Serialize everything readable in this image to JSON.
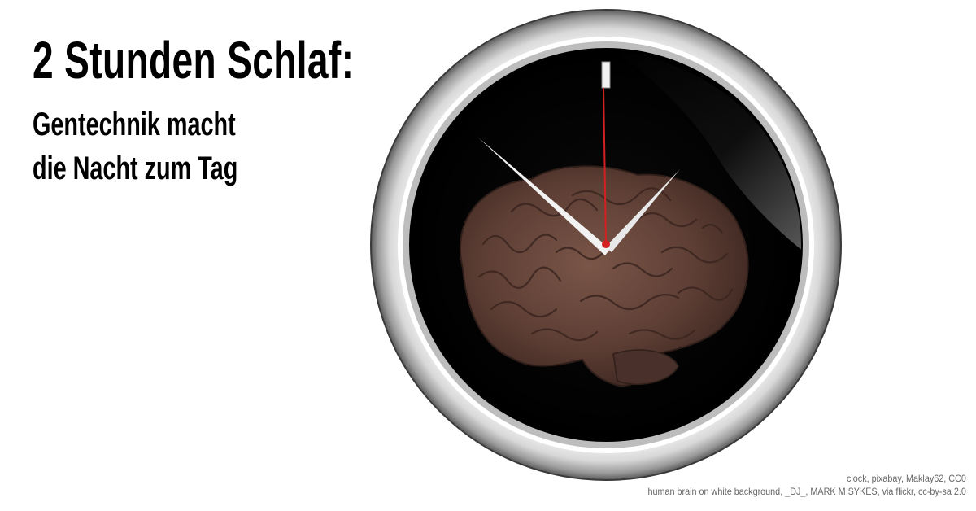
{
  "headline": {
    "title": "2 Stunden Schlaf:",
    "subtitle_line1": "Gentechnik macht",
    "subtitle_line2": "die Nacht zum Tag"
  },
  "credits": {
    "line1": "clock, pixabay, Maklay62, CC0",
    "line2": "human brain on white background, _DJ_, MARK M SYKES, via flickr, cc-by-sa 2.0"
  },
  "image": {
    "clock_face_color": "#000000",
    "clock_rim_color": "#e6e6e6",
    "brain_color": "#5a3b32",
    "second_hand_color": "#d32020",
    "hand_color": "#f2f2f2",
    "icons": [
      "clock-icon",
      "brain-icon"
    ]
  }
}
